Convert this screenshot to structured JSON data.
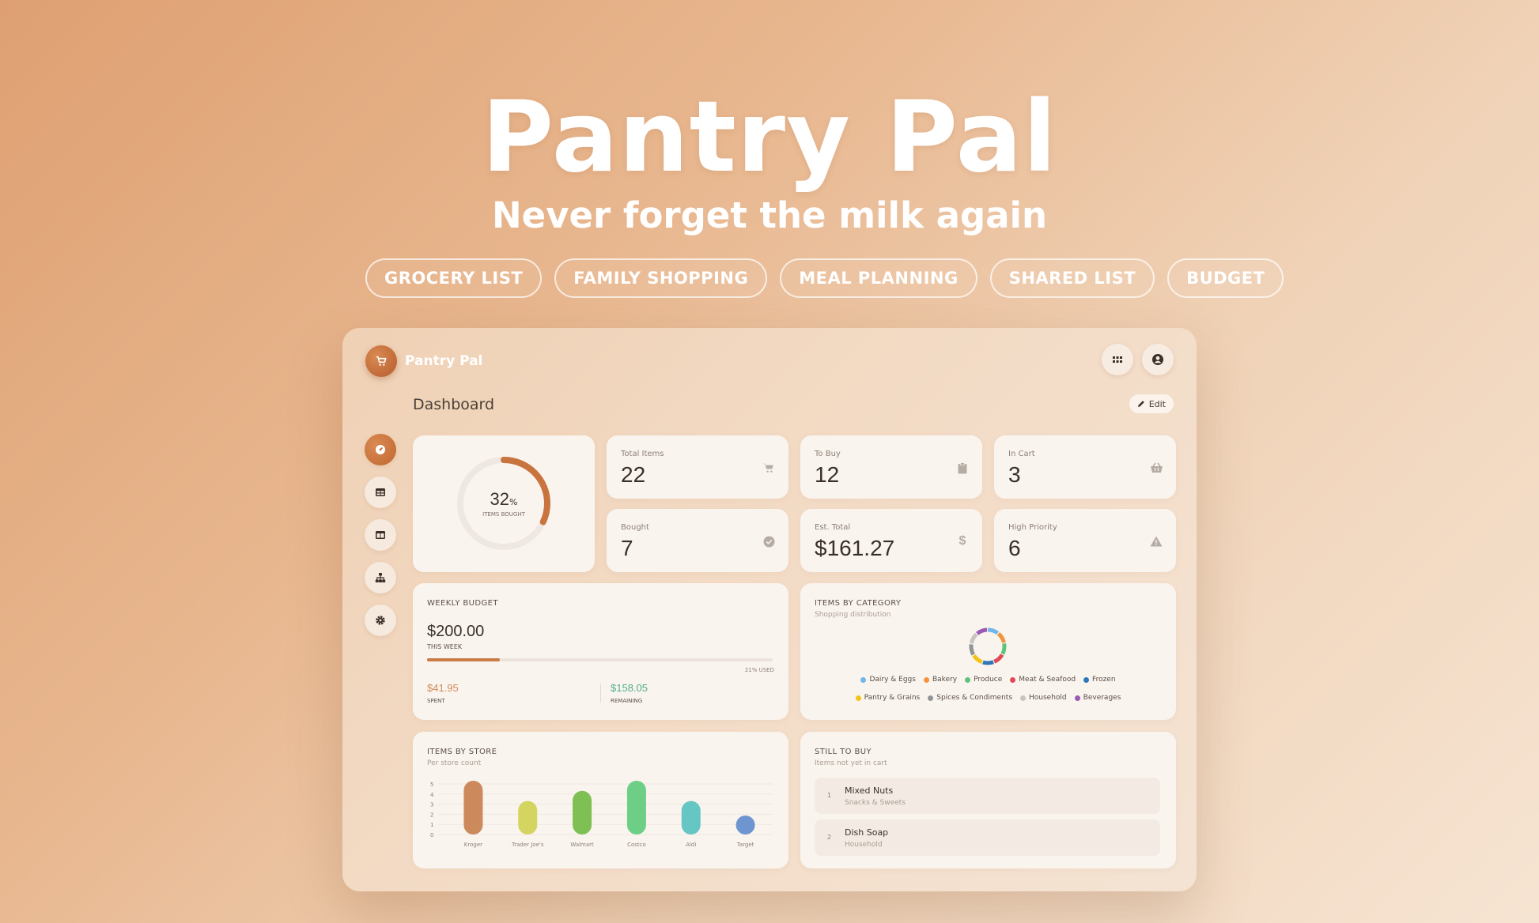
{
  "hero": {
    "title": "Pantry Pal",
    "subtitle": "Never forget the milk again",
    "tags": [
      "GROCERY LIST",
      "FAMILY SHOPPING",
      "MEAL PLANNING",
      "SHARED LIST",
      "BUDGET"
    ]
  },
  "app": {
    "name": "Pantry Pal",
    "page_title": "Dashboard",
    "edit_label": "Edit",
    "top_icons": [
      "grid-icon",
      "user-circle-icon"
    ],
    "sidebar_icons": [
      "gauge-icon",
      "table-icon",
      "columns-icon",
      "sitemap-icon",
      "gear-icon"
    ]
  },
  "progress": {
    "percent": "32",
    "percent_sign": "%",
    "label": "ITEMS BOUGHT",
    "fraction": 0.32
  },
  "stats": {
    "total_items": {
      "label": "Total Items",
      "value": "22",
      "icon": "cart-icon"
    },
    "to_buy": {
      "label": "To Buy",
      "value": "12",
      "icon": "clipboard-icon"
    },
    "in_cart": {
      "label": "In Cart",
      "value": "3",
      "icon": "basket-icon"
    },
    "bought": {
      "label": "Bought",
      "value": "7",
      "icon": "check-circle-icon"
    },
    "est_total": {
      "label": "Est. Total",
      "value": "$161.27",
      "icon": "dollar-icon"
    },
    "high_priority": {
      "label": "High Priority",
      "value": "6",
      "icon": "warning-icon"
    }
  },
  "budget": {
    "title": "WEEKLY BUDGET",
    "amount": "$200.00",
    "period": "THIS WEEK",
    "used_label": "21% USED",
    "used_fraction": 0.21,
    "spent": "$41.95",
    "spent_label": "SPENT",
    "remaining": "$158.05",
    "remaining_label": "REMAINING",
    "colors": {
      "spent": "#d08a5a",
      "remaining": "#4fae8c",
      "bar": "#c97a45"
    }
  },
  "category": {
    "title": "ITEMS BY CATEGORY",
    "subtitle": "Shopping distribution",
    "legend_row1": [
      {
        "name": "Dairy & Eggs",
        "color": "#6fb6ea"
      },
      {
        "name": "Bakery",
        "color": "#f0953a"
      },
      {
        "name": "Produce",
        "color": "#5dc37a"
      },
      {
        "name": "Meat & Seafood",
        "color": "#e04c55"
      },
      {
        "name": "Frozen",
        "color": "#2e78b8"
      }
    ],
    "legend_row2": [
      {
        "name": "Pantry & Grains",
        "color": "#f2c318"
      },
      {
        "name": "Spices & Condiments",
        "color": "#8f9496"
      },
      {
        "name": "Household",
        "color": "#c9c4bf"
      },
      {
        "name": "Beverages",
        "color": "#9b59b6"
      }
    ]
  },
  "chart_data": {
    "type": "bar",
    "title": "ITEMS BY STORE",
    "subtitle": "Per store count",
    "categories": [
      "Kroger",
      "Trader Joe's",
      "Walmart",
      "Costco",
      "Aldi",
      "Target"
    ],
    "values": [
      5,
      3,
      4,
      5,
      3,
      1
    ],
    "colors": [
      "#cc8a5c",
      "#d4d460",
      "#7fc055",
      "#6dcf86",
      "#66c6c4",
      "#6f95d0"
    ],
    "ylim": [
      0,
      5
    ],
    "yticks": [
      "0",
      "1",
      "2",
      "3",
      "4",
      "5"
    ],
    "xlabel": "",
    "ylabel": ""
  },
  "still_to_buy": {
    "title": "STILL TO BUY",
    "subtitle": "Items not yet in cart",
    "items": [
      {
        "num": "1",
        "name": "Mixed Nuts",
        "category": "Snacks & Sweets"
      },
      {
        "num": "2",
        "name": "Dish Soap",
        "category": "Household"
      }
    ]
  }
}
